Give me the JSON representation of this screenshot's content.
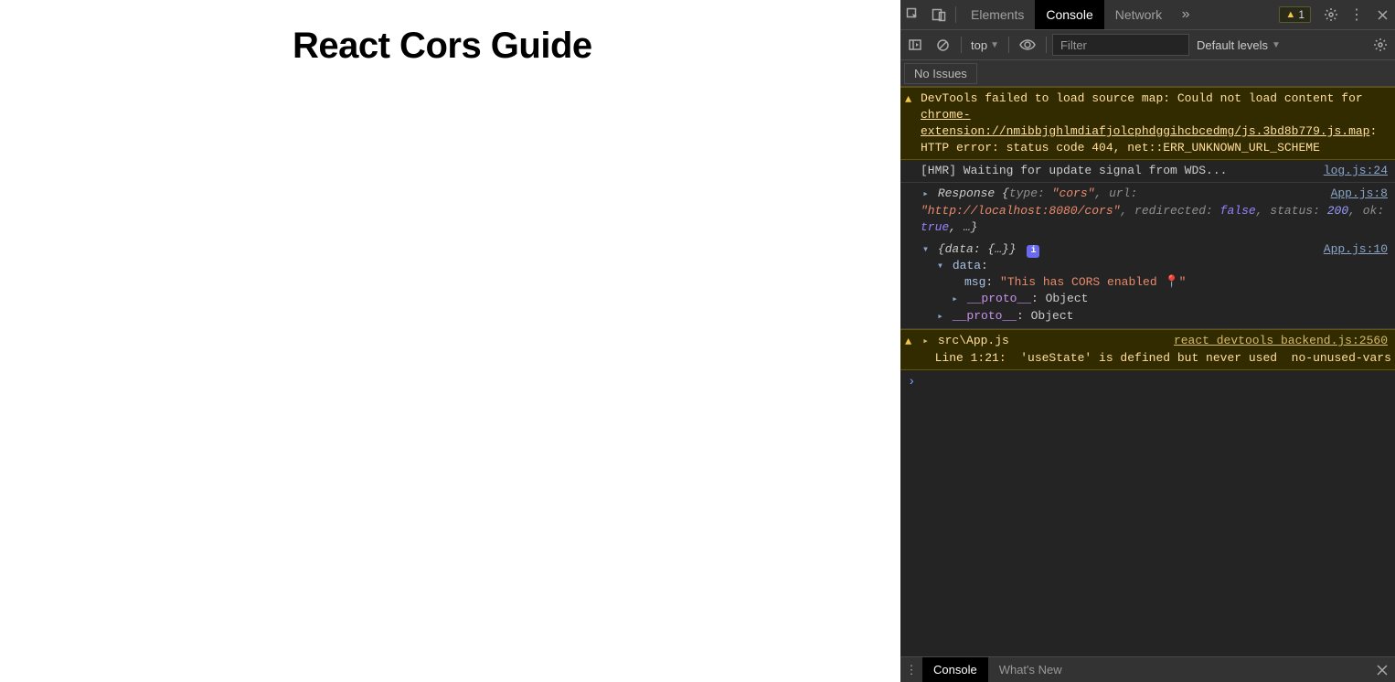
{
  "page": {
    "heading": "React Cors Guide"
  },
  "devtools": {
    "tabs": {
      "elements": "Elements",
      "console": "Console",
      "network": "Network"
    },
    "warn_count": "1",
    "toolbar": {
      "context": "top",
      "filter_placeholder": "Filter",
      "levels": "Default levels"
    },
    "issues_bar": {
      "no_issues": "No Issues"
    },
    "drawer": {
      "console": "Console",
      "whats_new": "What's New"
    }
  },
  "logs": {
    "warn_sourcemap": {
      "lead": "DevTools failed to load source map: Could not load content for ",
      "link": "chrome-extension://nmibbjghlmdiafjolcphdggihcbcedmg/js.3bd8b779.js.map",
      "tail": ": HTTP error: status code 404, net::ERR_UNKNOWN_URL_SCHEME"
    },
    "hmr": {
      "text": "[HMR] Waiting for update signal from WDS...",
      "src": "log.js:24"
    },
    "resp": {
      "src": "App.js:8",
      "open": "Response {",
      "k_type": "type: ",
      "v_type": "\"cors\"",
      "k_url": "url: ",
      "v_url": "\"http://localhost:8080/cors\"",
      "k_redir": "redirected: ",
      "v_redir": "false",
      "k_status": "status: ",
      "v_status": "200",
      "k_ok": "ok: ",
      "v_ok": "true",
      "close": ", …}"
    },
    "obj": {
      "src": "App.js:10",
      "root": "{data: {…}}",
      "data_key": "data",
      "msg_key": "msg",
      "msg_val": "\"This has CORS enabled 📍\"",
      "proto_key": "__proto__",
      "proto_val": ": Object"
    },
    "warn_lint": {
      "src": "react_devtools_backend.js:2560",
      "file": "src\\App.js",
      "body": "  Line 1:21:  'useState' is defined but never used  no-unused-vars"
    }
  }
}
